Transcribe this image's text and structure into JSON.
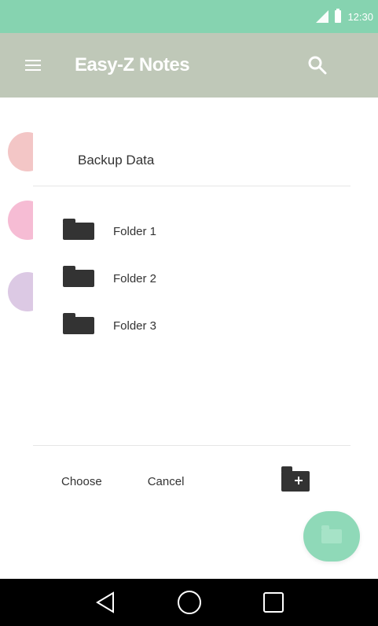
{
  "status_bar": {
    "time": "12:30",
    "icons": [
      "signal-icon",
      "battery-icon"
    ]
  },
  "app_bar": {
    "title": "Easy-Z Notes",
    "menu_icon": "hamburger-menu-icon",
    "search_icon": "search-icon"
  },
  "dialog": {
    "title": "Backup Data",
    "folders": [
      {
        "label": "Folder 1",
        "icon": "folder-icon"
      },
      {
        "label": "Folder 2",
        "icon": "folder-icon"
      },
      {
        "label": "Folder 3",
        "icon": "folder-icon"
      }
    ],
    "actions": {
      "choose_label": "Choose",
      "cancel_label": "Cancel",
      "new_folder_icon": "new-folder-icon"
    }
  },
  "fab": {
    "icon": "add-folder-icon"
  },
  "navigation": {
    "back_icon": "back-triangle-icon",
    "home_icon": "home-circle-icon",
    "recents_icon": "recents-square-icon"
  },
  "colors": {
    "status_bar": "#86d3b0",
    "app_bar": "#bfc8b8",
    "fab": "#8fd9b8",
    "nav_bar": "#000000"
  }
}
